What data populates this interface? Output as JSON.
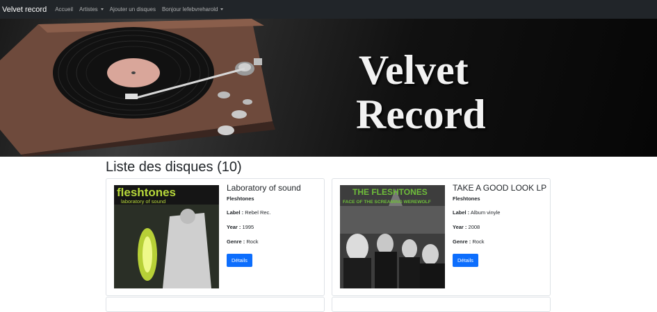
{
  "navbar": {
    "brand": "Velvet record",
    "items": [
      {
        "label": "Accueil",
        "dropdown": false
      },
      {
        "label": "Artistes",
        "dropdown": true
      },
      {
        "label": "Ajouter un disques",
        "dropdown": false
      },
      {
        "label": "Bonjour lefebvreharold",
        "dropdown": true
      }
    ]
  },
  "hero": {
    "line1": "Velvet",
    "line2": "Record"
  },
  "main": {
    "title": "Liste des disques (10)",
    "records": [
      {
        "title": "Laboratory of sound",
        "artist": "Fleshtones",
        "label_key": "Label :",
        "label": "Rebel Rec.",
        "year_key": "Year :",
        "year": "1995",
        "genre_key": "Genre :",
        "genre": "Rock",
        "button": "Détails",
        "cover_text_top": "fleshtones",
        "cover_text_sub": "laboratory of sound"
      },
      {
        "title": "TAKE A GOOD LOOK LP",
        "artist": "Fleshtones",
        "label_key": "Label :",
        "label": "Album vinyle",
        "year_key": "Year :",
        "year": "2008",
        "genre_key": "Genre :",
        "genre": "Rock",
        "button": "Détails",
        "cover_text_top": "THE FLESHTONES",
        "cover_text_sub": "FACE OF THE SCREAMING WEREWOLF"
      }
    ]
  },
  "colors": {
    "navbar_bg": "#212529",
    "button_bg": "#0d6efd",
    "cover1_text": "#b7d83a",
    "cover2_text": "#6fbf3a"
  }
}
